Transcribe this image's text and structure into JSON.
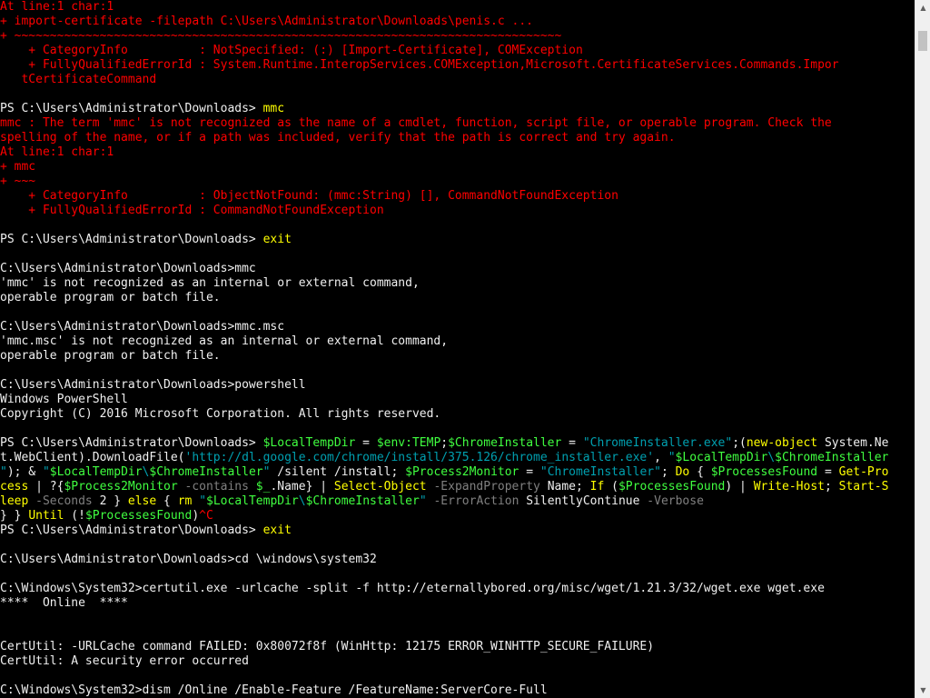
{
  "colors": {
    "default": "#c0c0c0",
    "error": "#ff0000",
    "prompt": "#f0f0f0",
    "command": "#ffff00",
    "string": "#00a0b0",
    "parameter": "#808080",
    "variable": "#40ff40",
    "text": "#f0f0f0"
  },
  "scrollbar": {
    "up_arrow_icon": "triangle-up",
    "down_arrow_icon": "triangle-down",
    "up_glyph": "▲",
    "down_glyph": "▼"
  },
  "lines": [
    [
      {
        "t": "At line:1 char:1",
        "c": "error"
      }
    ],
    [
      {
        "t": "+ import-certificate -filepath C:\\Users\\Administrator\\Downloads\\penis.c ...",
        "c": "error"
      }
    ],
    [
      {
        "t": "+ ~~~~~~~~~~~~~~~~~~~~~~~~~~~~~~~~~~~~~~~~~~~~~~~~~~~~~~~~~~~~~~~~~~~~~~~~~~~~~",
        "c": "error"
      }
    ],
    [
      {
        "t": "    + CategoryInfo          : NotSpecified: (:) [Import-Certificate], COMException",
        "c": "error"
      }
    ],
    [
      {
        "t": "    + FullyQualifiedErrorId : System.Runtime.InteropServices.COMException,Microsoft.CertificateServices.Commands.Impor",
        "c": "error"
      }
    ],
    [
      {
        "t": "   tCertificateCommand",
        "c": "error"
      }
    ],
    [
      {
        "t": "",
        "c": "default"
      }
    ],
    [
      {
        "t": "PS C:\\Users\\Administrator\\Downloads> ",
        "c": "prompt"
      },
      {
        "t": "mmc",
        "c": "command"
      }
    ],
    [
      {
        "t": "mmc : The term 'mmc' is not recognized as the name of a cmdlet, function, script file, or operable program. Check the",
        "c": "error"
      }
    ],
    [
      {
        "t": "spelling of the name, or if a path was included, verify that the path is correct and try again.",
        "c": "error"
      }
    ],
    [
      {
        "t": "At line:1 char:1",
        "c": "error"
      }
    ],
    [
      {
        "t": "+ mmc",
        "c": "error"
      }
    ],
    [
      {
        "t": "+ ~~~",
        "c": "error"
      }
    ],
    [
      {
        "t": "    + CategoryInfo          : ObjectNotFound: (mmc:String) [], CommandNotFoundException",
        "c": "error"
      }
    ],
    [
      {
        "t": "    + FullyQualifiedErrorId : CommandNotFoundException",
        "c": "error"
      }
    ],
    [
      {
        "t": "",
        "c": "default"
      }
    ],
    [
      {
        "t": "PS C:\\Users\\Administrator\\Downloads> ",
        "c": "prompt"
      },
      {
        "t": "exit",
        "c": "command"
      }
    ],
    [
      {
        "t": "",
        "c": "default"
      }
    ],
    [
      {
        "t": "C:\\Users\\Administrator\\Downloads>mmc",
        "c": "text"
      }
    ],
    [
      {
        "t": "'mmc' is not recognized as an internal or external command,",
        "c": "text"
      }
    ],
    [
      {
        "t": "operable program or batch file.",
        "c": "text"
      }
    ],
    [
      {
        "t": "",
        "c": "default"
      }
    ],
    [
      {
        "t": "C:\\Users\\Administrator\\Downloads>mmc.msc",
        "c": "text"
      }
    ],
    [
      {
        "t": "'mmc.msc' is not recognized as an internal or external command,",
        "c": "text"
      }
    ],
    [
      {
        "t": "operable program or batch file.",
        "c": "text"
      }
    ],
    [
      {
        "t": "",
        "c": "default"
      }
    ],
    [
      {
        "t": "C:\\Users\\Administrator\\Downloads>powershell",
        "c": "text"
      }
    ],
    [
      {
        "t": "Windows PowerShell",
        "c": "text"
      }
    ],
    [
      {
        "t": "Copyright (C) 2016 Microsoft Corporation. All rights reserved.",
        "c": "text"
      }
    ],
    [
      {
        "t": "",
        "c": "default"
      }
    ],
    [
      {
        "t": "PS C:\\Users\\Administrator\\Downloads> ",
        "c": "prompt"
      },
      {
        "t": "$LocalTempDir",
        "c": "variable"
      },
      {
        "t": " = ",
        "c": "text"
      },
      {
        "t": "$env:TEMP",
        "c": "variable"
      },
      {
        "t": ";",
        "c": "text"
      },
      {
        "t": "$ChromeInstaller",
        "c": "variable"
      },
      {
        "t": " = ",
        "c": "text"
      },
      {
        "t": "\"ChromeInstaller.exe\"",
        "c": "string"
      },
      {
        "t": ";(",
        "c": "text"
      },
      {
        "t": "new-object",
        "c": "command"
      },
      {
        "t": " System.Ne",
        "c": "text"
      }
    ],
    [
      {
        "t": "t.WebClient).DownloadFile(",
        "c": "text"
      },
      {
        "t": "'http://dl.google.com/chrome/install/375.126/chrome_installer.exe'",
        "c": "string"
      },
      {
        "t": ", ",
        "c": "text"
      },
      {
        "t": "\"",
        "c": "string"
      },
      {
        "t": "$LocalTempDir",
        "c": "variable"
      },
      {
        "t": "\\",
        "c": "string"
      },
      {
        "t": "$ChromeInstaller",
        "c": "variable"
      }
    ],
    [
      {
        "t": "\"",
        "c": "string"
      },
      {
        "t": "); & ",
        "c": "text"
      },
      {
        "t": "\"",
        "c": "string"
      },
      {
        "t": "$LocalTempDir",
        "c": "variable"
      },
      {
        "t": "\\",
        "c": "string"
      },
      {
        "t": "$ChromeInstaller",
        "c": "variable"
      },
      {
        "t": "\"",
        "c": "string"
      },
      {
        "t": " /silent /install; ",
        "c": "text"
      },
      {
        "t": "$Process2Monitor",
        "c": "variable"
      },
      {
        "t": " = ",
        "c": "text"
      },
      {
        "t": "\"ChromeInstaller\"",
        "c": "string"
      },
      {
        "t": "; ",
        "c": "text"
      },
      {
        "t": "Do",
        "c": "command"
      },
      {
        "t": " { ",
        "c": "text"
      },
      {
        "t": "$ProcessesFound",
        "c": "variable"
      },
      {
        "t": " = ",
        "c": "text"
      },
      {
        "t": "Get-Pro",
        "c": "command"
      }
    ],
    [
      {
        "t": "cess",
        "c": "command"
      },
      {
        "t": " | ?{",
        "c": "text"
      },
      {
        "t": "$Process2Monitor",
        "c": "variable"
      },
      {
        "t": " -contains ",
        "c": "parameter"
      },
      {
        "t": "$_",
        "c": "variable"
      },
      {
        "t": ".Name} | ",
        "c": "text"
      },
      {
        "t": "Select-Object",
        "c": "command"
      },
      {
        "t": " -ExpandProperty ",
        "c": "parameter"
      },
      {
        "t": "Name; ",
        "c": "text"
      },
      {
        "t": "If",
        "c": "command"
      },
      {
        "t": " (",
        "c": "text"
      },
      {
        "t": "$ProcessesFound",
        "c": "variable"
      },
      {
        "t": ") | ",
        "c": "text"
      },
      {
        "t": "Write-Host",
        "c": "command"
      },
      {
        "t": "; ",
        "c": "text"
      },
      {
        "t": "Start-S",
        "c": "command"
      }
    ],
    [
      {
        "t": "leep",
        "c": "command"
      },
      {
        "t": " -Seconds ",
        "c": "parameter"
      },
      {
        "t": "2 } ",
        "c": "text"
      },
      {
        "t": "else",
        "c": "command"
      },
      {
        "t": " { ",
        "c": "text"
      },
      {
        "t": "rm",
        "c": "command"
      },
      {
        "t": " ",
        "c": "text"
      },
      {
        "t": "\"",
        "c": "string"
      },
      {
        "t": "$LocalTempDir",
        "c": "variable"
      },
      {
        "t": "\\",
        "c": "string"
      },
      {
        "t": "$ChromeInstaller",
        "c": "variable"
      },
      {
        "t": "\"",
        "c": "string"
      },
      {
        "t": " -ErrorAction ",
        "c": "parameter"
      },
      {
        "t": "SilentlyContinue ",
        "c": "text"
      },
      {
        "t": "-Verbose",
        "c": "parameter"
      }
    ],
    [
      {
        "t": "} } ",
        "c": "text"
      },
      {
        "t": "Until",
        "c": "command"
      },
      {
        "t": " (!",
        "c": "text"
      },
      {
        "t": "$ProcessesFound",
        "c": "variable"
      },
      {
        "t": ")",
        "c": "text"
      },
      {
        "t": "^C",
        "c": "error"
      }
    ],
    [
      {
        "t": "PS C:\\Users\\Administrator\\Downloads> ",
        "c": "prompt"
      },
      {
        "t": "exit",
        "c": "command"
      }
    ],
    [
      {
        "t": "",
        "c": "default"
      }
    ],
    [
      {
        "t": "C:\\Users\\Administrator\\Downloads>cd \\windows\\system32",
        "c": "text"
      }
    ],
    [
      {
        "t": "",
        "c": "default"
      }
    ],
    [
      {
        "t": "C:\\Windows\\System32>certutil.exe -urlcache -split -f http://eternallybored.org/misc/wget/1.21.3/32/wget.exe wget.exe",
        "c": "text"
      }
    ],
    [
      {
        "t": "****  Online  ****",
        "c": "text"
      }
    ],
    [
      {
        "t": "",
        "c": "default"
      }
    ],
    [
      {
        "t": "",
        "c": "default"
      }
    ],
    [
      {
        "t": "CertUtil: -URLCache command FAILED: 0x80072f8f (WinHttp: 12175 ERROR_WINHTTP_SECURE_FAILURE)",
        "c": "text"
      }
    ],
    [
      {
        "t": "CertUtil: A security error occurred",
        "c": "text"
      }
    ],
    [
      {
        "t": "",
        "c": "default"
      }
    ],
    [
      {
        "t": "C:\\Windows\\System32>dism /Online /Enable-Feature /FeatureName:ServerCore-Full",
        "c": "text"
      }
    ]
  ]
}
